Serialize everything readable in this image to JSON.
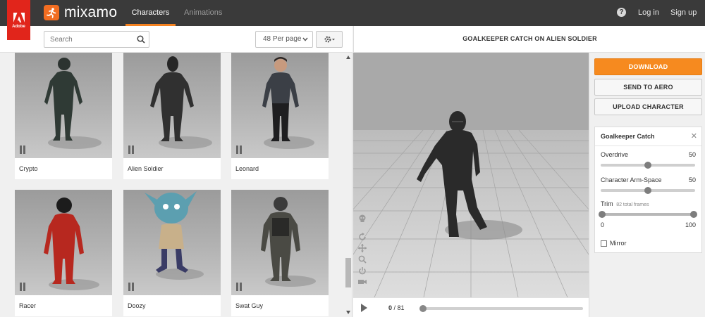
{
  "header": {
    "adobe_word": "Adobe",
    "brand": "mixamo",
    "tabs": [
      {
        "label": "Characters",
        "active": true
      },
      {
        "label": "Animations",
        "active": false
      }
    ],
    "login": "Log in",
    "signup": "Sign up",
    "accent_color": "#f58220",
    "bar_color": "#3a3a3a"
  },
  "toolbar": {
    "search_placeholder": "Search",
    "per_page": "48 Per page"
  },
  "characters": [
    {
      "name": "Crypto"
    },
    {
      "name": "Alien Soldier"
    },
    {
      "name": "Leonard"
    },
    {
      "name": "Racer"
    },
    {
      "name": "Doozy"
    },
    {
      "name": "Swat Guy"
    }
  ],
  "viewer": {
    "animation_title": "GOALKEEPER CATCH ON ALIEN SOLDIER",
    "current_frame": "0",
    "total_frames": "/ 81"
  },
  "side": {
    "download": "DOWNLOAD",
    "send_to_aero": "SEND TO AERO",
    "upload_character": "UPLOAD CHARACTER",
    "panel_title": "Goalkeeper Catch",
    "overdrive_label": "Overdrive",
    "overdrive_value": "50",
    "overdrive_level": 0.5,
    "arm_space_label": "Character Arm-Space",
    "arm_space_value": "50",
    "arm_space_level": 0.5,
    "trim_label": "Trim",
    "trim_sub": "82 total frames",
    "trim_min": "0",
    "trim_max": "100",
    "mirror_label": "Mirror",
    "mirror_checked": false,
    "primary_color": "#f68a1f"
  }
}
